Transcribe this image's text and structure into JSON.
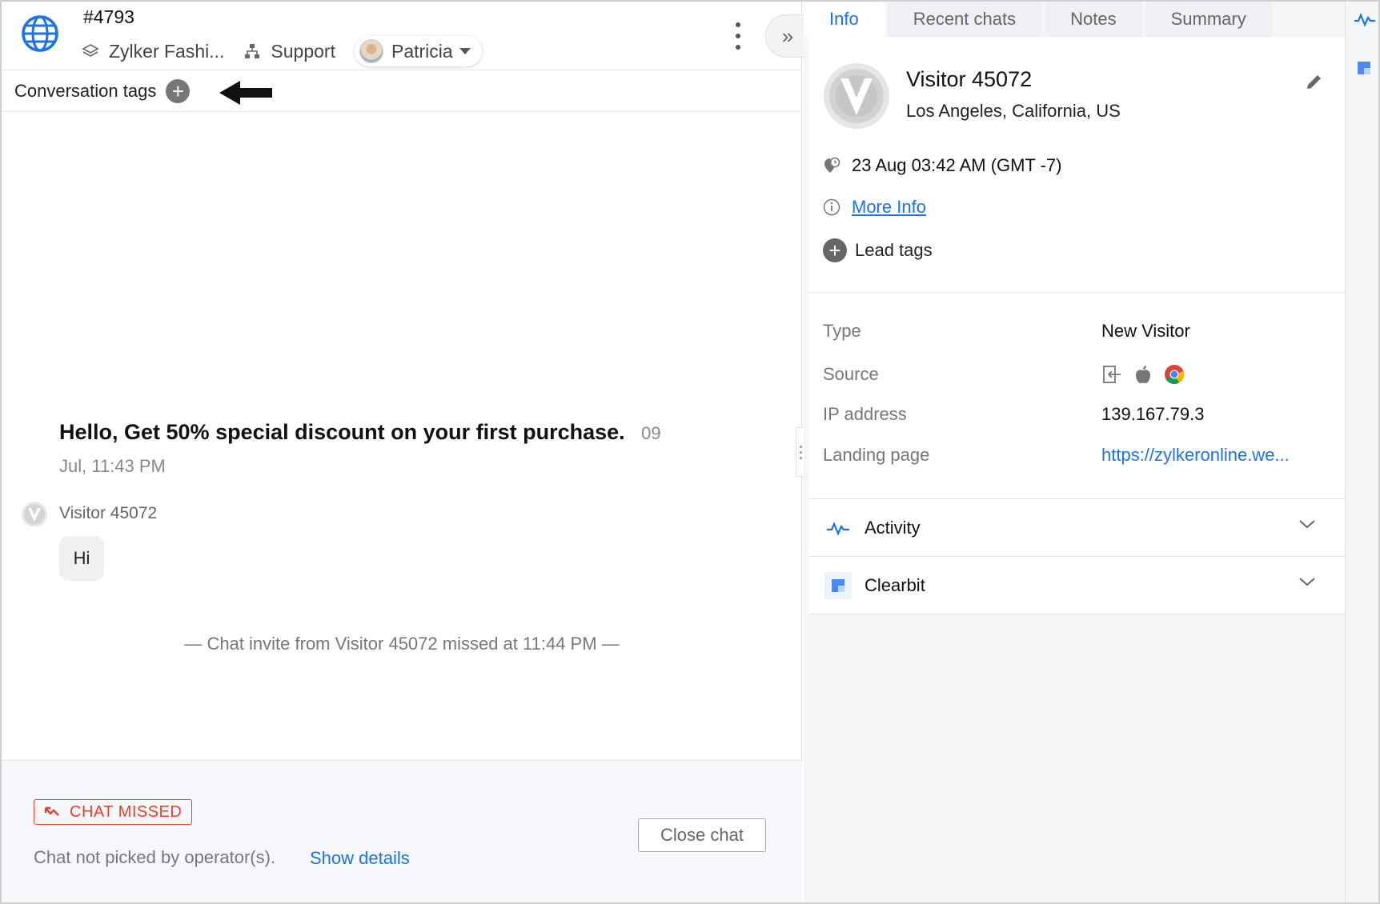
{
  "header": {
    "chat_id": "#4793",
    "brand": "Zylker Fashi...",
    "department": "Support",
    "operator": "Patricia"
  },
  "tags": {
    "label": "Conversation tags"
  },
  "messages": {
    "system_text": "Hello, Get 50% special discount on your first purchase.",
    "system_time_a": "09",
    "system_time_b": "Jul, 11:43 PM",
    "visitor_name": "Visitor 45072",
    "visitor_bubble": "Hi",
    "missed_notice": "— Chat invite from Visitor 45072 missed at 11:44 PM —"
  },
  "footer": {
    "status_badge": "CHAT MISSED",
    "note": "Chat not picked by operator(s).",
    "show_details": "Show details",
    "close_chat": "Close chat"
  },
  "tabs": [
    "Info",
    "Recent chats",
    "Notes",
    "Summary"
  ],
  "visitor": {
    "name": "Visitor 45072",
    "location": "Los Angeles, California, US",
    "datetime": "23 Aug 03:42 AM  (GMT -7)",
    "more_info": "More Info",
    "lead_tags": "Lead tags"
  },
  "details": {
    "type_label": "Type",
    "type_value": "New Visitor",
    "source_label": "Source",
    "ip_label": "IP address",
    "ip_value": "139.167.79.3",
    "landing_label": "Landing page",
    "landing_value": "https://zylkeronline.we..."
  },
  "sections": {
    "activity": "Activity",
    "clearbit": "Clearbit"
  },
  "colors": {
    "accent": "#1a73e8",
    "missed": "#e8412b"
  }
}
